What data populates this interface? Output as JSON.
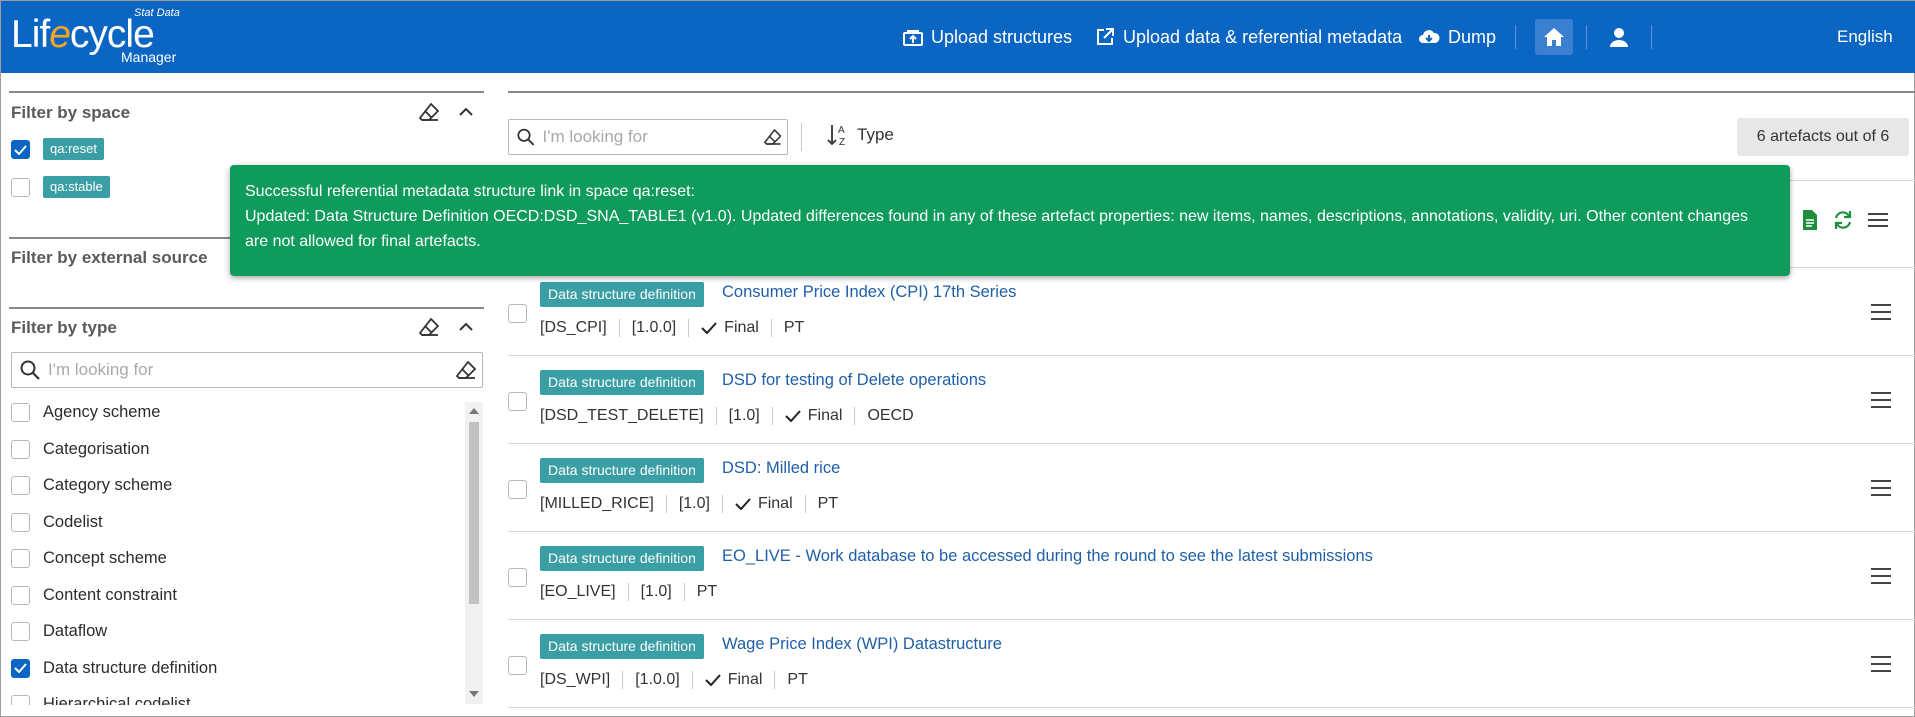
{
  "header": {
    "logo": {
      "main_pre": "Lif",
      "main_e": "e",
      "main_post": "cycle",
      "top": "Stat Data",
      "bottom": "Manager"
    },
    "nav": {
      "upload_structures": "Upload structures",
      "upload_data": "Upload data & referential metadata",
      "dump": "Dump",
      "language": "English"
    }
  },
  "colors": {
    "header": "#0b65c2",
    "chip": "#3a9ea5",
    "toast": "#0f9b5c",
    "link": "#1f5fa8"
  },
  "sidebar": {
    "space": {
      "title": "Filter by space",
      "items": [
        {
          "label": "qa:reset",
          "checked": true
        },
        {
          "label": "qa:stable",
          "checked": false
        }
      ]
    },
    "external": {
      "title": "Filter by external source"
    },
    "type": {
      "title": "Filter by type",
      "search_placeholder": "I'm looking for",
      "items": [
        {
          "label": "Agency scheme",
          "checked": false
        },
        {
          "label": "Categorisation",
          "checked": false
        },
        {
          "label": "Category scheme",
          "checked": false
        },
        {
          "label": "Codelist",
          "checked": false
        },
        {
          "label": "Concept scheme",
          "checked": false
        },
        {
          "label": "Content constraint",
          "checked": false
        },
        {
          "label": "Dataflow",
          "checked": false
        },
        {
          "label": "Data structure definition",
          "checked": true
        },
        {
          "label": "Hierarchical codelist",
          "checked": false
        }
      ]
    }
  },
  "main": {
    "search_placeholder": "I'm looking for",
    "sort_label": "Type",
    "count": "6 artefacts out of 6",
    "rows": [
      {
        "tag": "Data structure definition",
        "title": "Consumer Price Index (CPI) 17th Series",
        "id": "[DS_CPI]",
        "version": "[1.0.0]",
        "final": "Final",
        "agency": "PT"
      },
      {
        "tag": "Data structure definition",
        "title": "DSD for testing of Delete operations",
        "id": "[DSD_TEST_DELETE]",
        "version": "[1.0]",
        "final": "Final",
        "agency": "OECD"
      },
      {
        "tag": "Data structure definition",
        "title": "DSD: Milled rice",
        "id": "[MILLED_RICE]",
        "version": "[1.0]",
        "final": "Final",
        "agency": "PT"
      },
      {
        "tag": "Data structure definition",
        "title": "EO_LIVE - Work database to be accessed during the round to see the latest submissions",
        "id": "[EO_LIVE]",
        "version": "[1.0]",
        "final": "",
        "agency": "PT"
      },
      {
        "tag": "Data structure definition",
        "title": "Wage Price Index (WPI) Datastructure",
        "id": "[DS_WPI]",
        "version": "[1.0.0]",
        "final": "Final",
        "agency": "PT"
      }
    ]
  },
  "toast": {
    "line1": "Successful referential metadata structure link in space qa:reset:",
    "line2": "Updated: Data Structure Definition OECD:DSD_SNA_TABLE1 (v1.0). Updated differences found in any of these artefact properties: new items, names, descriptions, annotations, validity, uri. Other content changes are not allowed for final artefacts."
  }
}
